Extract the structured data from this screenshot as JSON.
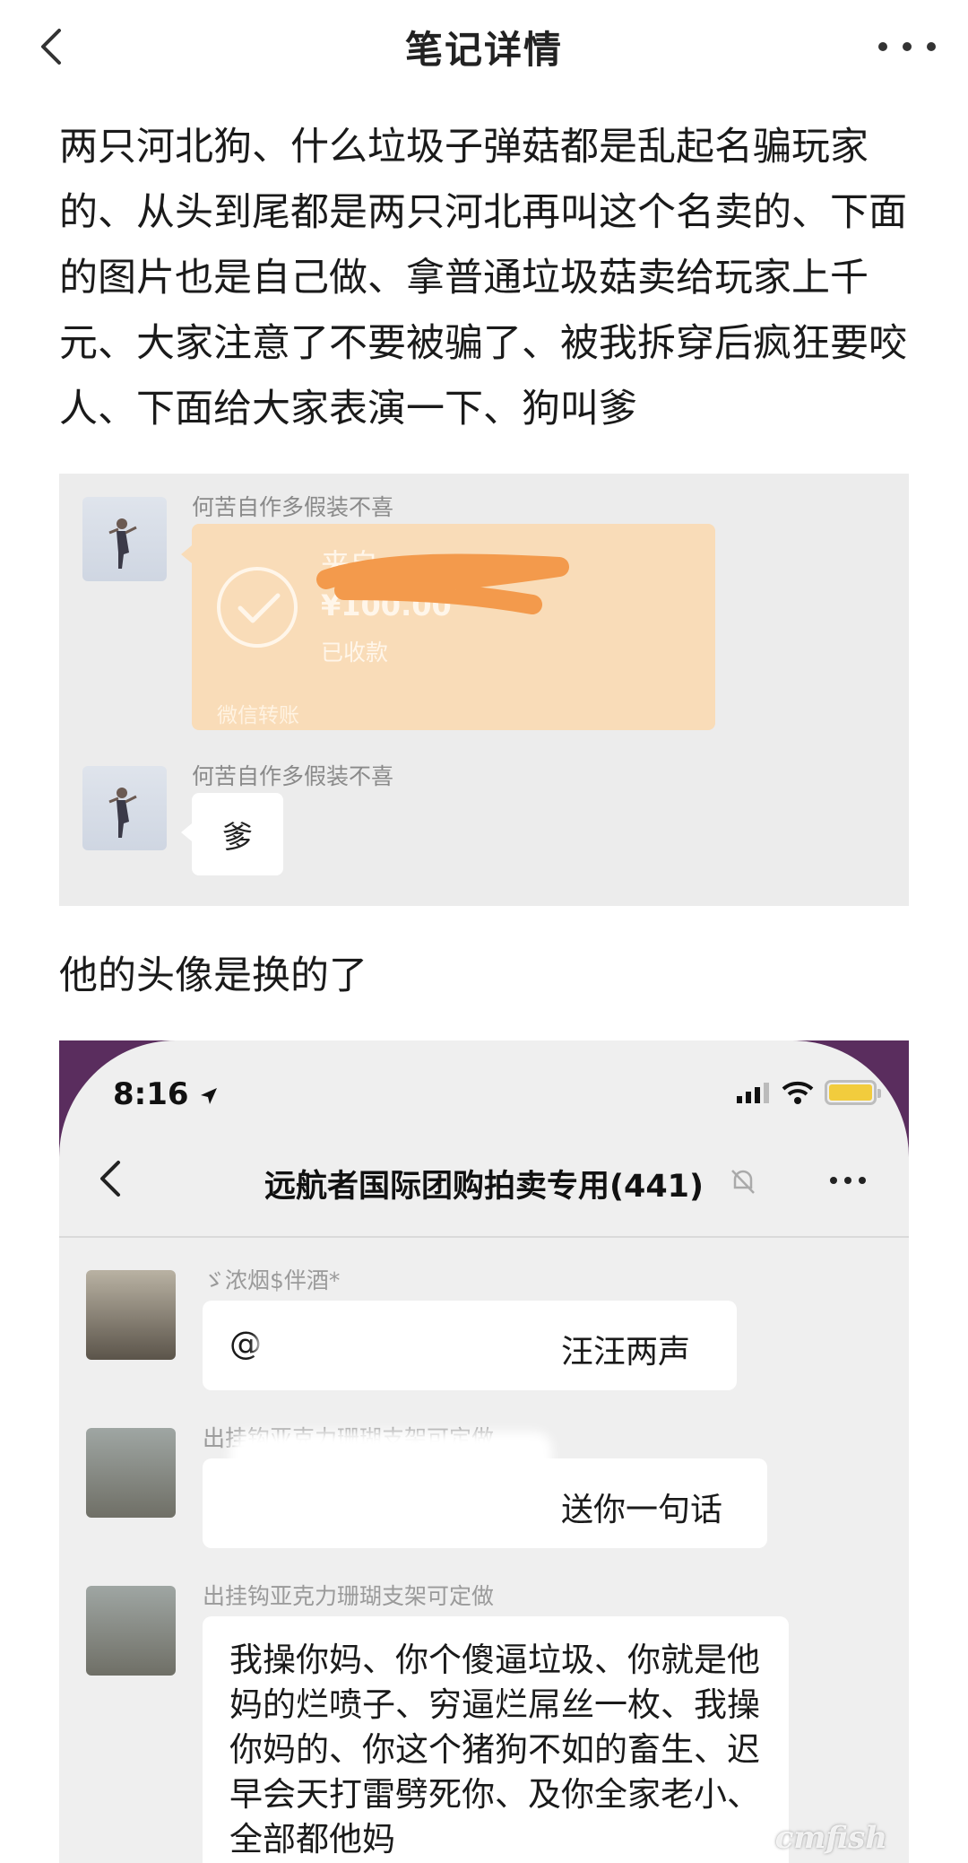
{
  "header": {
    "title": "笔记详情",
    "back_icon": "chevron-left-icon",
    "more_icon": "more-dots-icon"
  },
  "note": {
    "paragraph1": "两只河北狗、什么垃圾子弹菇都是乱起名骗玩家的、从头到尾都是两只河北再叫这个名卖的、下面的图片也是自己做、拿普通垃圾菇卖给玩家上千元、大家注意了不要被骗了、被我拆穿后疯狂要咬人、下面给大家表演一下、狗叫爹",
    "paragraph2": "他的头像是换的了"
  },
  "screenshot1": {
    "nickname": "何苦自作多假装不喜",
    "transfer_from": "来自",
    "transfer_amount": "¥100.00",
    "transfer_status": "已收款",
    "transfer_footer": "微信转账",
    "reply_nickname": "何苦自作多假装不喜",
    "reply_text": "爹",
    "redaction_color": "#f39a4c"
  },
  "screenshot2": {
    "status_time": "8:16",
    "chat_title": "远航者国际团购拍卖专用(441)",
    "messages": [
      {
        "nickname": "ゞ浓烟$伴酒*",
        "text": "汪汪两声",
        "prefix": "@"
      },
      {
        "nickname": "出挂钩亚克力珊瑚支架可定做",
        "text": "送你一句话"
      },
      {
        "nickname": "出挂钩亚克力珊瑚支架可定做",
        "text": "我操你妈、你个傻逼垃圾、你就是他妈的烂喷子、穷逼烂屌丝一枚、我操你妈的、你这个猪狗不如的畜生、迟早会天打雷劈死你、及你全家老小、全部都他妈"
      }
    ],
    "frame_color": "#5a2d5e"
  },
  "watermark": "cmfish"
}
